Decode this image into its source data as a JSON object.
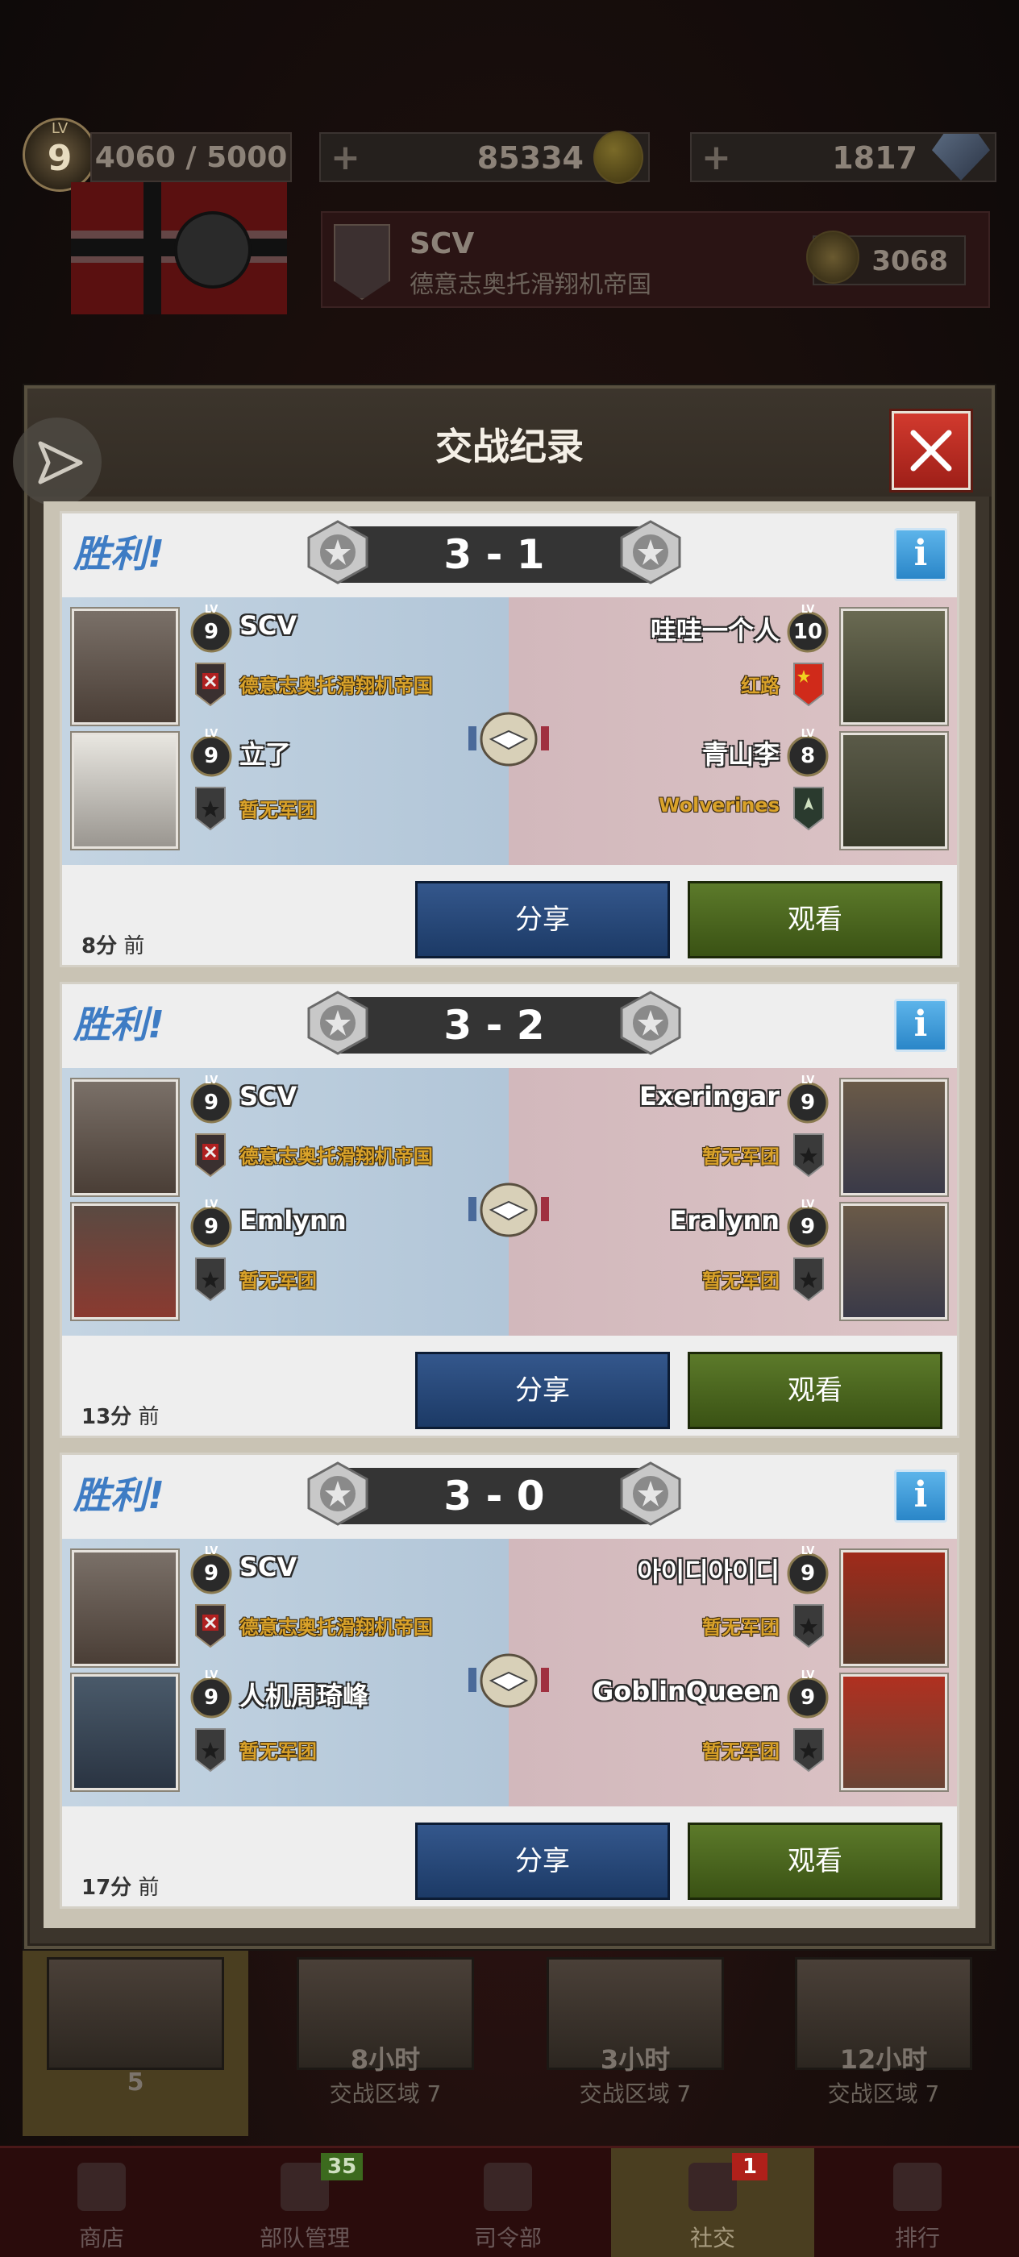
{
  "hud": {
    "level_label": "LV",
    "level": "9",
    "xp": "4060 / 5000",
    "coins_plus": "+",
    "coins": "85334",
    "gems_plus": "+",
    "gems": "1817",
    "guild_name": "SCV",
    "guild_subtitle": "德意志奥托滑翔机帝国",
    "medals": "3068"
  },
  "modal": {
    "title": "交战纪录",
    "close_label": "X"
  },
  "records": [
    {
      "result": "胜利!",
      "score": "3 - 1",
      "info": "i",
      "share": "分享",
      "watch": "观看",
      "time_value": "8分",
      "time_suffix": " 前",
      "left": [
        {
          "level": "9",
          "name": "SCV",
          "guild": "德意志奥托滑翔机帝国",
          "portrait": "headset-soldier"
        },
        {
          "level": "9",
          "name": "立了",
          "guild": "暂无军团",
          "portrait": "winter-soldier"
        }
      ],
      "right": [
        {
          "level": "10",
          "name": "哇哇一个人",
          "guild": "红路",
          "portrait": "us-soldier"
        },
        {
          "level": "8",
          "name": "青山李",
          "guild": "Wolverines",
          "portrait": "us-soldier"
        }
      ]
    },
    {
      "result": "胜利!",
      "score": "3 - 2",
      "info": "i",
      "share": "分享",
      "watch": "观看",
      "time_value": "13分",
      "time_suffix": " 前",
      "left": [
        {
          "level": "9",
          "name": "SCV",
          "guild": "德意志奥托滑翔机帝国",
          "portrait": "headset-soldier"
        },
        {
          "level": "9",
          "name": "Emlynn",
          "guild": "暂无军团",
          "portrait": "officer"
        }
      ],
      "right": [
        {
          "level": "9",
          "name": "Exeringar",
          "guild": "暂无军团",
          "portrait": "us-soldier"
        },
        {
          "level": "9",
          "name": "Eralynn",
          "guild": "暂无军团",
          "portrait": "us-soldier"
        }
      ]
    },
    {
      "result": "胜利!",
      "score": "3 - 0",
      "info": "i",
      "share": "分享",
      "watch": "观看",
      "time_value": "17分",
      "time_suffix": " 前",
      "left": [
        {
          "level": "9",
          "name": "SCV",
          "guild": "德意志奥托滑翔机帝国",
          "portrait": "headset-soldier"
        },
        {
          "level": "9",
          "name": "人机周琦峰",
          "guild": "暂无军团",
          "portrait": "pilot-officer"
        }
      ],
      "right": [
        {
          "level": "9",
          "name": "아이디아이디",
          "guild": "暂无军团",
          "portrait": "soviet-soldier"
        },
        {
          "level": "9",
          "name": "GoblinQueen",
          "guild": "暂无军团",
          "portrait": "soviet-soldier"
        }
      ]
    }
  ],
  "crates": [
    {
      "t1": "5",
      "t2": ""
    },
    {
      "t1": "8小时",
      "t2": "交战区域 7"
    },
    {
      "t1": "3小时",
      "t2": "交战区域 7"
    },
    {
      "t1": "12小时",
      "t2": "交战区域 7"
    }
  ],
  "nav": [
    {
      "label": "商店",
      "badge": ""
    },
    {
      "label": "部队管理",
      "badge": "35"
    },
    {
      "label": "司令部",
      "badge": ""
    },
    {
      "label": "社交",
      "badge": "1"
    },
    {
      "label": "排行",
      "badge": ""
    }
  ],
  "colors": {
    "victory": "#3e7cc4",
    "guild_text": "#d9a22a",
    "share_button": "#2a4a7e",
    "watch_button": "#4e6a20",
    "close_button": "#c0302a"
  }
}
